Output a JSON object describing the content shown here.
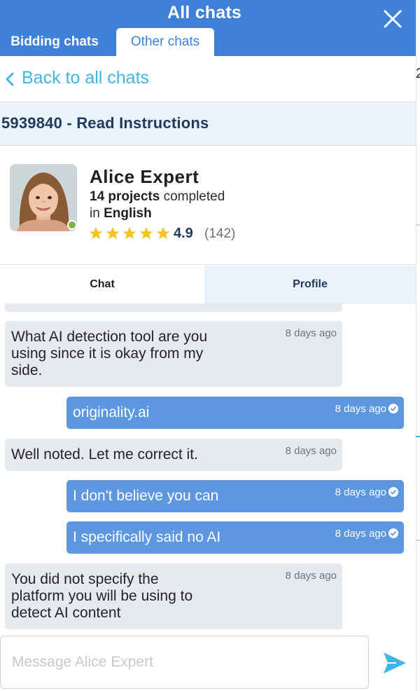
{
  "header": {
    "title": "All chats",
    "tabs": [
      {
        "label": "Bidding chats",
        "active": false
      },
      {
        "label": "Other chats",
        "active": true
      }
    ],
    "color": "#3f80d9"
  },
  "back": {
    "label": "Back to all chats"
  },
  "project": {
    "title": "5939840 - Read Instructions"
  },
  "expert": {
    "name": "Alice Expert",
    "projects_count": "14 projects",
    "projects_suffix": "completed",
    "language_prefix": "in",
    "language": "English",
    "rating": "4.9",
    "rating_count": "(142)",
    "stars": 5,
    "status": "online"
  },
  "chat_tabs": [
    {
      "label": "Chat",
      "active": true
    },
    {
      "label": "Profile",
      "active": false
    }
  ],
  "messages": [
    {
      "direction": "in",
      "text_lines": [
        "What AI detection tool are you",
        "using since it is okay from my",
        "side."
      ],
      "time": "8 days ago"
    },
    {
      "direction": "out",
      "text_lines": [
        "originality.ai"
      ],
      "time": "8 days ago",
      "read": true
    },
    {
      "direction": "in",
      "text_lines": [
        "Well noted. Let me correct it."
      ],
      "time": "8 days ago"
    },
    {
      "direction": "out",
      "text_lines": [
        "I don't believe you can"
      ],
      "time": "8 days ago",
      "read": true
    },
    {
      "direction": "out",
      "text_lines": [
        "I specifically said no AI"
      ],
      "time": "8 days ago",
      "read": true
    },
    {
      "direction": "in",
      "text_lines": [
        "You did not specify the",
        "platform you will be using to",
        "detect AI content"
      ],
      "time": "8 days ago"
    }
  ],
  "composer": {
    "placeholder": "Message Alice Expert",
    "value": ""
  },
  "background_page": {
    "edge_texts": [
      "2"
    ]
  }
}
